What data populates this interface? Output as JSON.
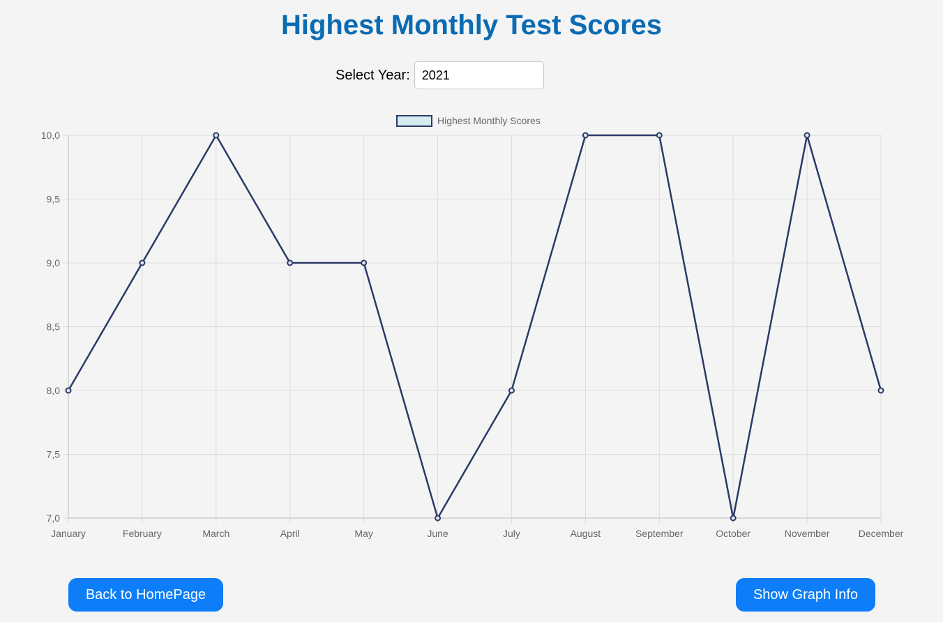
{
  "page": {
    "title": "Highest Monthly Test Scores",
    "year_label": "Select Year:",
    "year_value": "2021",
    "back_button": "Back to HomePage",
    "info_button": "Show Graph Info"
  },
  "colors": {
    "title": "#0a6bb3",
    "line": "#2b3a67",
    "legend_fill": "#d6ecef",
    "button": "#0d7ef7",
    "grid": "#dddddd",
    "tick_text": "#666666"
  },
  "chart_data": {
    "type": "line",
    "title": "",
    "xlabel": "",
    "ylabel": "",
    "categories": [
      "January",
      "February",
      "March",
      "April",
      "May",
      "June",
      "July",
      "August",
      "September",
      "October",
      "November",
      "December"
    ],
    "series": [
      {
        "name": "Highest Monthly Scores",
        "values": [
          8,
          9,
          10,
          9,
          9,
          7,
          8,
          10,
          10,
          7,
          10,
          8
        ]
      }
    ],
    "ylim": [
      7,
      10
    ],
    "y_ticks": [
      "10,0",
      "9,5",
      "9,0",
      "8,5",
      "8,0",
      "7,5",
      "7,0"
    ],
    "grid": true,
    "legend_position": "top"
  }
}
